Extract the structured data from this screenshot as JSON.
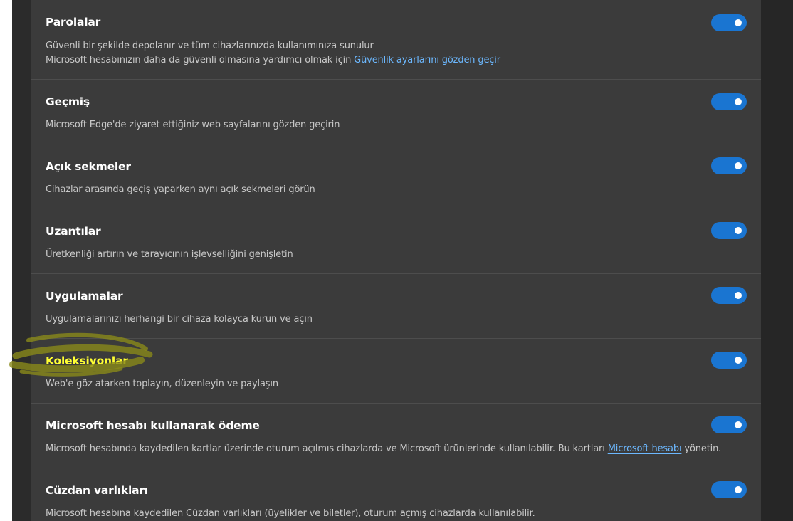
{
  "rows": [
    {
      "title": "Parolalar",
      "desc_line1": "Güvenli bir şekilde depolanır ve tüm cihazlarınızda kullanımınıza sunulur",
      "desc_line2_prefix": "Microsoft hesabınızın daha da güvenli olmasına yardımcı olmak için ",
      "desc_line2_link": "Güvenlik ayarlarını gözden geçir",
      "enabled": true
    },
    {
      "title": "Geçmiş",
      "desc": "Microsoft Edge'de ziyaret ettiğiniz web sayfalarını gözden geçirin",
      "enabled": true
    },
    {
      "title": "Açık sekmeler",
      "desc": "Cihazlar arasında geçiş yaparken aynı açık sekmeleri görün",
      "enabled": true
    },
    {
      "title": "Uzantılar",
      "desc": "Üretkenliği artırın ve tarayıcının işlevselliğini genişletin",
      "enabled": true
    },
    {
      "title": "Uygulamalar",
      "desc": "Uygulamalarınızı herhangi bir cihaza kolayca kurun ve açın",
      "enabled": true
    },
    {
      "title": "Koleksiyonlar",
      "desc": "Web'e göz atarken toplayın, düzenleyin ve paylaşın",
      "enabled": true
    },
    {
      "title": "Microsoft hesabı kullanarak ödeme",
      "desc_prefix": "Microsoft hesabında kaydedilen kartlar üzerinde oturum açılmış cihazlarda ve Microsoft ürünlerinde kullanılabilir. Bu kartları ",
      "desc_link": "Microsoft hesabı",
      "desc_suffix": " yönetin.",
      "enabled": true
    },
    {
      "title": "Cüzdan varlıkları",
      "desc": "Microsoft hesabına kaydedilen Cüzdan varlıkları (üyelikler ve biletler), oturum açmış cihazlarda kullanılabilir.",
      "enabled": true
    }
  ],
  "colors": {
    "toggle_on": "#1a75d1",
    "link": "#6cb8ff",
    "highlight_text": "#ffff33",
    "highlight_marker": "#8a8a1a"
  }
}
